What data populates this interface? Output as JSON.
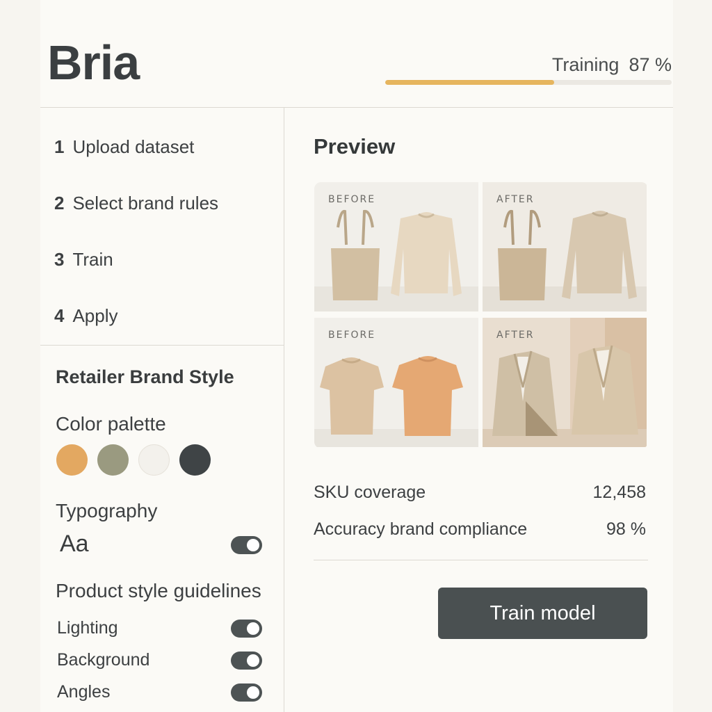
{
  "header": {
    "brand": "Bria",
    "training_label": "Training",
    "training_value": "87 %",
    "training_progress": 0.59
  },
  "steps": [
    {
      "num": "1",
      "label": "Upload dataset"
    },
    {
      "num": "2",
      "label": "Select brand rules"
    },
    {
      "num": "3",
      "label": "Train"
    },
    {
      "num": "4",
      "label": "Apply"
    }
  ],
  "brand_style": {
    "title": "Retailer Brand Style",
    "palette_label": "Color palette",
    "palette": [
      "#e3a861",
      "#9a9a80",
      "#f3f1ec",
      "#3f4446"
    ],
    "typography_label": "Typography",
    "typography_sample": "Aa",
    "typography_enabled": true,
    "guidelines_label": "Product style guidelines",
    "guidelines": [
      {
        "label": "Lighting",
        "enabled": true
      },
      {
        "label": "Background",
        "enabled": true
      },
      {
        "label": "Angles",
        "enabled": true
      }
    ]
  },
  "preview": {
    "title": "Preview",
    "tiles": [
      {
        "tag": "BEFORE"
      },
      {
        "tag": "AFTER"
      },
      {
        "tag": "BEFORE"
      },
      {
        "tag": "AFTER"
      }
    ]
  },
  "stats": {
    "sku_label": "SKU coverage",
    "sku_value": "12,458",
    "accuracy_label": "Accuracy brand compliance",
    "accuracy_value": "98 %"
  },
  "actions": {
    "train_label": "Train model"
  },
  "colors": {
    "accent": "#e6b55e",
    "button": "#4a5051",
    "toggle_on": "#4d5354"
  }
}
